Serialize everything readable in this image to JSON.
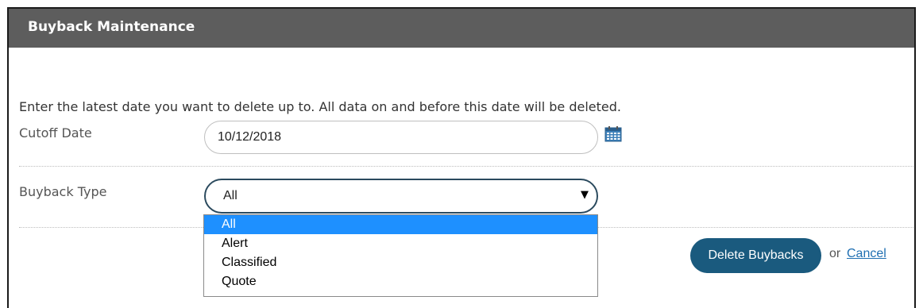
{
  "panel": {
    "title": "Buyback Maintenance"
  },
  "instructions": "Enter the latest date you want to delete up to. All data on and before this date will be deleted.",
  "cutoff_date": {
    "label": "Cutoff Date",
    "value": "10/12/2018",
    "icon": "calendar-icon"
  },
  "buyback_type": {
    "label": "Buyback Type",
    "selected": "All",
    "arrow": "▼",
    "options": [
      "All",
      "Alert",
      "Classified",
      "Quote"
    ],
    "highlighted_option": "All"
  },
  "actions": {
    "delete_label": "Delete Buybacks",
    "or_text": "or",
    "cancel_label": "Cancel"
  },
  "colors": {
    "header_bg": "#5d5d5d",
    "button_bg": "#1a5a7e",
    "highlight": "#1e90ff",
    "link": "#1f6fb2"
  }
}
